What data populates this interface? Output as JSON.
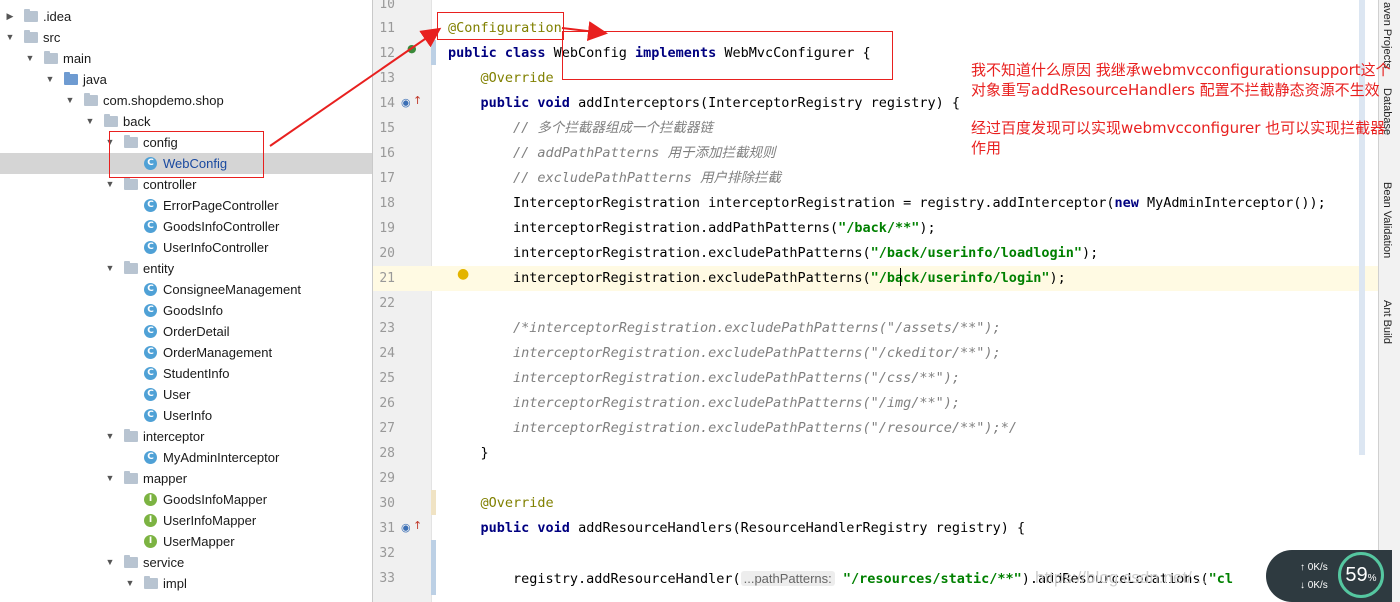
{
  "project_tree": {
    "items": [
      {
        "label": "src",
        "depth": 0,
        "icon": "folder-icon",
        "expanded": true
      },
      {
        "label": "main",
        "depth": 1,
        "icon": "folder-icon",
        "expanded": true
      },
      {
        "label": "java",
        "depth": 2,
        "icon": "folder-blue-icon",
        "expanded": true
      },
      {
        "label": "com.shopdemo.shop",
        "depth": 3,
        "icon": "package-icon",
        "expanded": true
      },
      {
        "label": "back",
        "depth": 4,
        "icon": "package-icon",
        "expanded": true
      },
      {
        "label": "config",
        "depth": 5,
        "icon": "package-icon",
        "expanded": true
      },
      {
        "label": "WebConfig",
        "depth": 6,
        "icon": "class-icon",
        "selected": true
      },
      {
        "label": "controller",
        "depth": 5,
        "icon": "package-icon",
        "expanded": true
      },
      {
        "label": "ErrorPageController",
        "depth": 6,
        "icon": "class-icon"
      },
      {
        "label": "GoodsInfoController",
        "depth": 6,
        "icon": "class-icon"
      },
      {
        "label": "UserInfoController",
        "depth": 6,
        "icon": "class-icon"
      },
      {
        "label": "entity",
        "depth": 5,
        "icon": "package-icon",
        "expanded": true
      },
      {
        "label": "ConsigneeManagement",
        "depth": 6,
        "icon": "class-icon"
      },
      {
        "label": "GoodsInfo",
        "depth": 6,
        "icon": "class-icon"
      },
      {
        "label": "OrderDetail",
        "depth": 6,
        "icon": "class-icon"
      },
      {
        "label": "OrderManagement",
        "depth": 6,
        "icon": "class-icon"
      },
      {
        "label": "StudentInfo",
        "depth": 6,
        "icon": "class-icon"
      },
      {
        "label": "User",
        "depth": 6,
        "icon": "class-icon"
      },
      {
        "label": "UserInfo",
        "depth": 6,
        "icon": "class-icon"
      },
      {
        "label": "interceptor",
        "depth": 5,
        "icon": "package-icon",
        "expanded": true
      },
      {
        "label": "MyAdminInterceptor",
        "depth": 6,
        "icon": "class-icon"
      },
      {
        "label": "mapper",
        "depth": 5,
        "icon": "package-icon",
        "expanded": true
      },
      {
        "label": "GoodsInfoMapper",
        "depth": 6,
        "icon": "interface-icon"
      },
      {
        "label": "UserInfoMapper",
        "depth": 6,
        "icon": "interface-icon"
      },
      {
        "label": "UserMapper",
        "depth": 6,
        "icon": "interface-icon"
      },
      {
        "label": "service",
        "depth": 5,
        "icon": "package-icon",
        "expanded": true
      },
      {
        "label": "impl",
        "depth": 6,
        "icon": "package-icon",
        "expanded": true
      }
    ],
    "idea_label": ".idea"
  },
  "editor": {
    "first_line_number": "10",
    "current_line": "21",
    "lines": [
      {
        "n": "11",
        "parts": [
          {
            "t": "@Configuration",
            "c": "ann"
          }
        ]
      },
      {
        "n": "12",
        "parts": [
          {
            "t": "public class ",
            "c": "kw"
          },
          {
            "t": "WebConfig ",
            "c": ""
          },
          {
            "t": "implements ",
            "c": "kw"
          },
          {
            "t": "WebMvcConfigurer {",
            "c": ""
          }
        ]
      },
      {
        "n": "13",
        "parts": [
          {
            "t": "    ",
            "c": ""
          },
          {
            "t": "@Override",
            "c": "ann"
          }
        ]
      },
      {
        "n": "14",
        "parts": [
          {
            "t": "    ",
            "c": ""
          },
          {
            "t": "public void ",
            "c": "kw"
          },
          {
            "t": "addInterceptors(InterceptorRegistry registry) {",
            "c": ""
          }
        ]
      },
      {
        "n": "15",
        "parts": [
          {
            "t": "        ",
            "c": ""
          },
          {
            "t": "// 多个拦截器组成一个拦截器链",
            "c": "cm"
          }
        ]
      },
      {
        "n": "16",
        "parts": [
          {
            "t": "        ",
            "c": ""
          },
          {
            "t": "// addPathPatterns 用于添加拦截规则",
            "c": "cm"
          }
        ]
      },
      {
        "n": "17",
        "parts": [
          {
            "t": "        ",
            "c": ""
          },
          {
            "t": "// excludePathPatterns 用户排除拦截",
            "c": "cm"
          }
        ]
      },
      {
        "n": "18",
        "parts": [
          {
            "t": "        InterceptorRegistration interceptorRegistration = registry.addInterceptor(",
            "c": ""
          },
          {
            "t": "new ",
            "c": "kw"
          },
          {
            "t": "MyAdminInterceptor());",
            "c": ""
          }
        ]
      },
      {
        "n": "19",
        "parts": [
          {
            "t": "        interceptorRegistration.addPathPatterns(",
            "c": ""
          },
          {
            "t": "\"/back/**\"",
            "c": "str"
          },
          {
            "t": ");",
            "c": ""
          }
        ]
      },
      {
        "n": "20",
        "parts": [
          {
            "t": "        interceptorRegistration.excludePathPatterns(",
            "c": ""
          },
          {
            "t": "\"/back/userinfo/loadlogin\"",
            "c": "str"
          },
          {
            "t": ");",
            "c": ""
          }
        ]
      },
      {
        "n": "21",
        "parts": [
          {
            "t": "        interceptorRegistration.excludePathPatterns(",
            "c": ""
          },
          {
            "t": "\"/back/userinfo/login\"",
            "c": "str"
          },
          {
            "t": ");",
            "c": ""
          }
        ]
      },
      {
        "n": "22",
        "parts": []
      },
      {
        "n": "23",
        "parts": [
          {
            "t": "        ",
            "c": ""
          },
          {
            "t": "/*interceptorRegistration.excludePathPatterns(\"/assets/**\");",
            "c": "cm"
          }
        ]
      },
      {
        "n": "24",
        "parts": [
          {
            "t": "        ",
            "c": ""
          },
          {
            "t": "interceptorRegistration.excludePathPatterns(\"/ckeditor/**\");",
            "c": "cm"
          }
        ]
      },
      {
        "n": "25",
        "parts": [
          {
            "t": "        ",
            "c": ""
          },
          {
            "t": "interceptorRegistration.excludePathPatterns(\"/css/**\");",
            "c": "cm"
          }
        ]
      },
      {
        "n": "26",
        "parts": [
          {
            "t": "        ",
            "c": ""
          },
          {
            "t": "interceptorRegistration.excludePathPatterns(\"/img/**\");",
            "c": "cm"
          }
        ]
      },
      {
        "n": "27",
        "parts": [
          {
            "t": "        ",
            "c": ""
          },
          {
            "t": "interceptorRegistration.excludePathPatterns(\"/resource/**\");*/",
            "c": "cm"
          }
        ]
      },
      {
        "n": "28",
        "parts": [
          {
            "t": "    }",
            "c": ""
          }
        ]
      },
      {
        "n": "29",
        "parts": []
      },
      {
        "n": "30",
        "parts": [
          {
            "t": "    ",
            "c": ""
          },
          {
            "t": "@Override",
            "c": "ann"
          }
        ]
      },
      {
        "n": "31",
        "parts": [
          {
            "t": "    ",
            "c": ""
          },
          {
            "t": "public void ",
            "c": "kw"
          },
          {
            "t": "addResourceHandlers(ResourceHandlerRegistry registry) {",
            "c": ""
          }
        ]
      },
      {
        "n": "32",
        "parts": []
      },
      {
        "n": "33",
        "parts": [
          {
            "t": "        registry.addResourceHandler(",
            "c": ""
          },
          {
            "t": "...pathPatterns:",
            "c": "hint"
          },
          {
            "t": " ",
            "c": ""
          },
          {
            "t": "\"/resources/static/**\"",
            "c": "str"
          },
          {
            "t": ").addResourceLocations(",
            "c": ""
          },
          {
            "t": "\"cl",
            "c": "str"
          }
        ]
      }
    ]
  },
  "annotation_note": {
    "line1": "我不知道什么原因 我继承webmvcconfigurationsupport这个对象重写addResourceHandlers 配置不拦截静态资源不生效",
    "line2": "经过百度发现可以实现webmvcconfigurer 也可以实现拦截器作用"
  },
  "right_toolbar": {
    "tabs": [
      "aven Projects",
      "Database",
      "Bean Validation",
      "Ant Build"
    ]
  },
  "net_meter": {
    "percent": "59",
    "percent_suffix": "%",
    "up": "0K/s",
    "down": "0K/s"
  },
  "watermark": "https://blog.csdn.net/...",
  "colors": {
    "annotation_red": "#e8201f",
    "keyword": "#000080",
    "string": "#008000"
  }
}
